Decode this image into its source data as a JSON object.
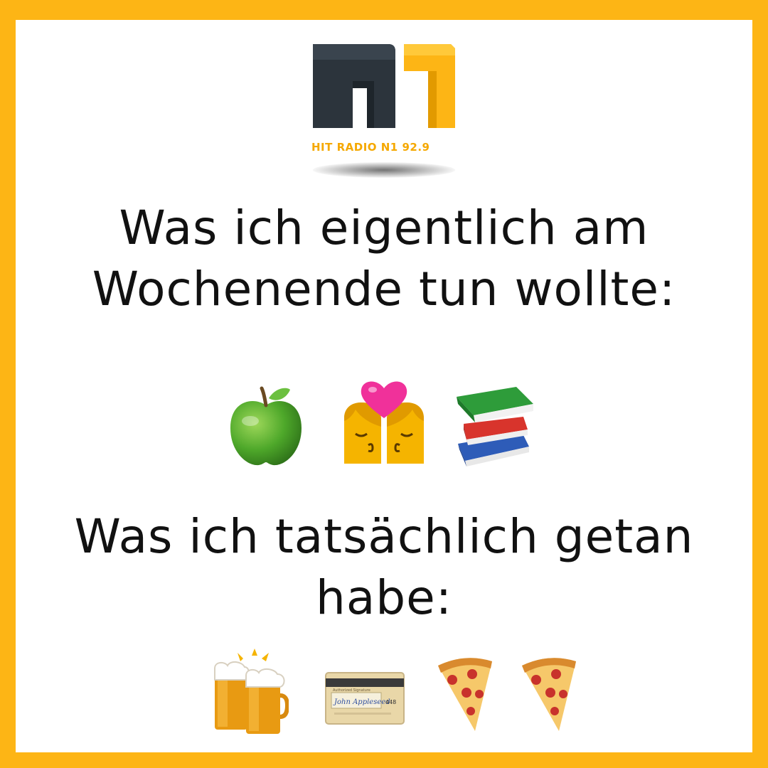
{
  "brand": {
    "logo_name": "N1",
    "caption": "HIT RADIO N1 92.9",
    "colors": {
      "dark": "#2C343C",
      "accent": "#FDB515"
    }
  },
  "heading_planned": {
    "line1": "Was ich eigentlich am",
    "line2": "Wochenende tun wollte:"
  },
  "planned_icons": [
    "green-apple-icon",
    "kissing-couple-icon",
    "books-icon"
  ],
  "heading_actual": {
    "line1": "Was ich tatsächlich getan",
    "line2": "habe:"
  },
  "actual_icons": [
    "beer-mugs-icon",
    "credit-card-icon",
    "pizza-slice-icon",
    "pizza-slice-icon"
  ],
  "card_text": {
    "signature_label": "Authorized Signature",
    "name": "John Appleseed",
    "code": "448"
  },
  "frame_color": "#FDB515"
}
